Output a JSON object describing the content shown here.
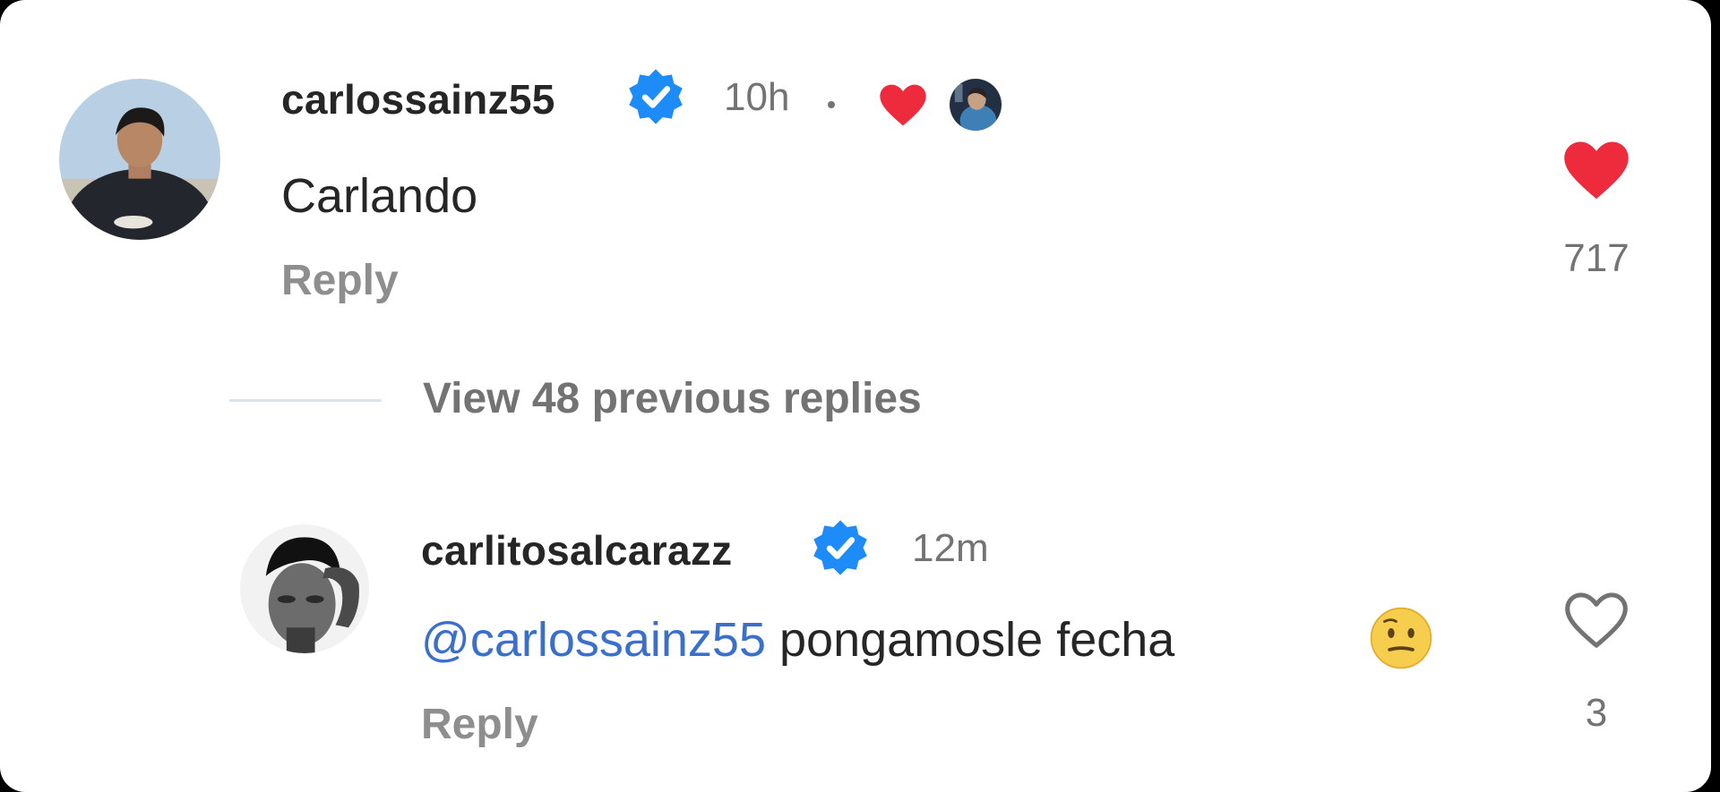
{
  "comments": [
    {
      "username": "carlossainz55",
      "time": "10h",
      "text": "Carlando",
      "reply_label": "Reply",
      "like_count": "717",
      "liked": true,
      "liked_by_author": true
    },
    {
      "username": "carlitosalcarazz",
      "time": "12m",
      "mention": "@carlossainz55",
      "text": " pongamosle fecha",
      "emoji": "slightly-frowning-face-emoji",
      "reply_label": "Reply",
      "like_count": "3",
      "liked": false
    }
  ],
  "view_replies_label": "View 48 previous replies",
  "colors": {
    "heart": "#ed2b3d",
    "verified": "#1d8cf8",
    "mention": "#3a6fcc",
    "muted_text": "#737373"
  }
}
